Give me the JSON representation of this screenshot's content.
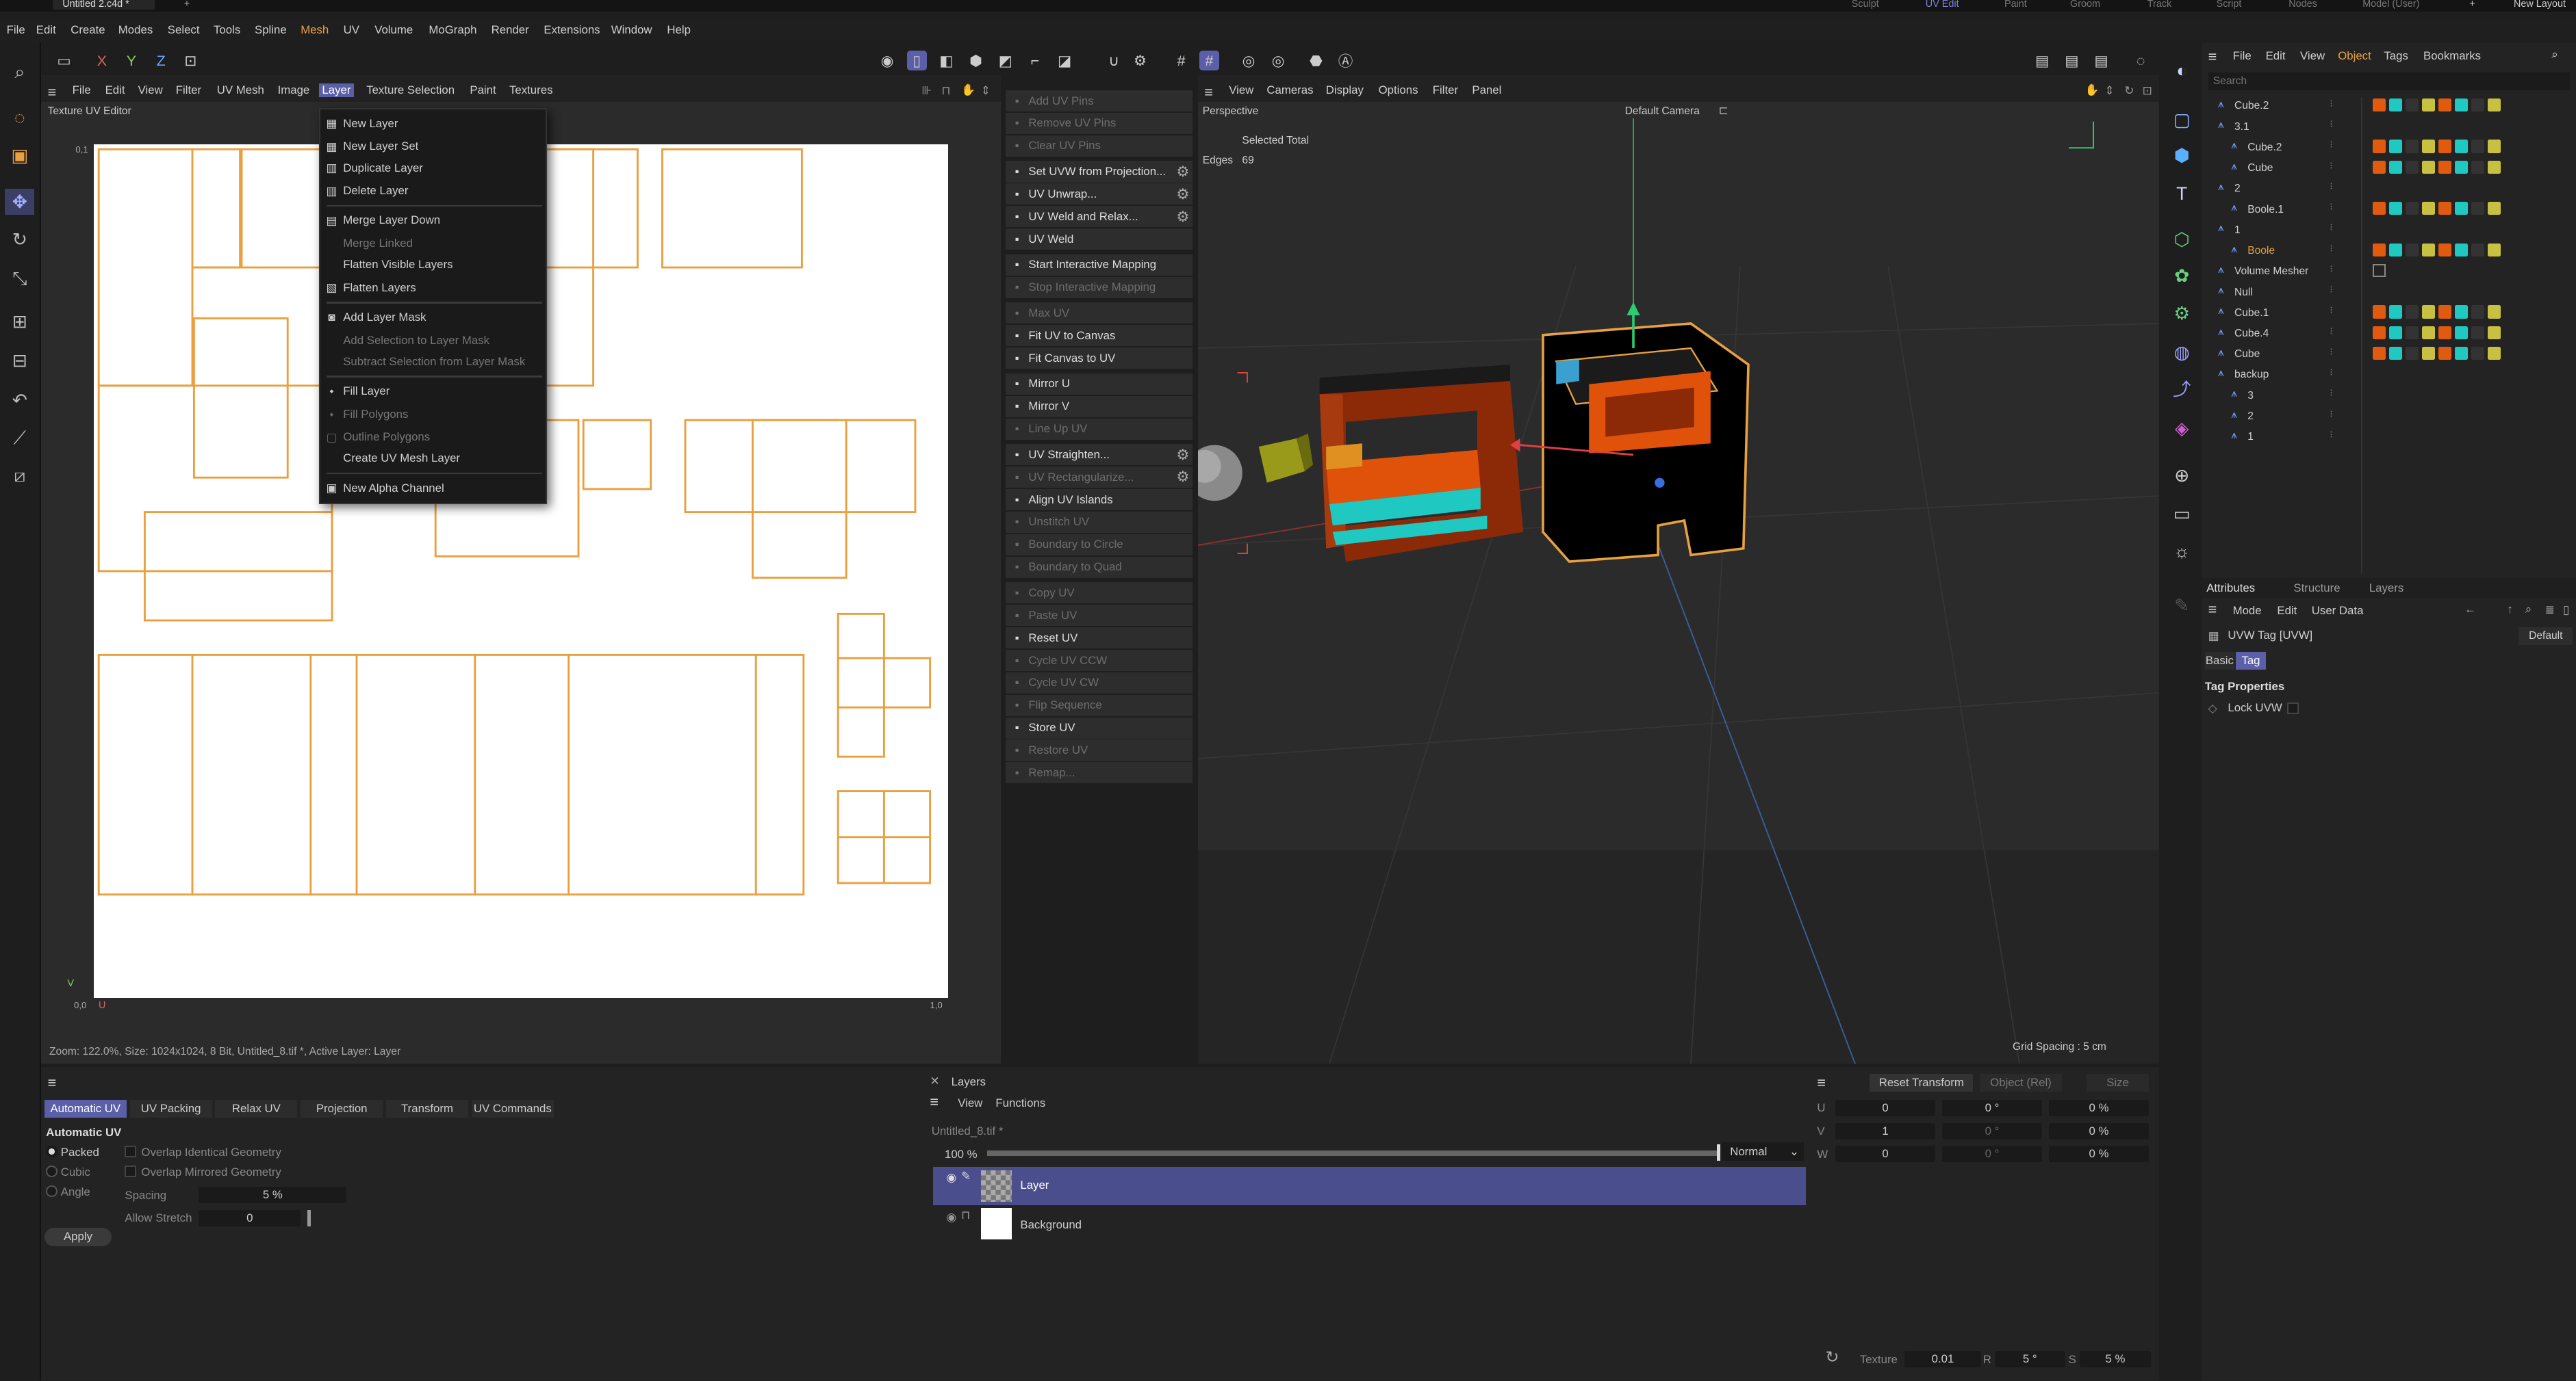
{
  "top_tabs": {
    "doc": "Untitled 2.c4d *",
    "layouts": [
      "Sculpt",
      "UV Edit",
      "Paint",
      "Groom",
      "Track",
      "Script",
      "Nodes",
      "Model (User)"
    ],
    "active_layout": "UV Edit",
    "new_layout": "New Layout"
  },
  "main_menu": [
    "File",
    "Edit",
    "Create",
    "Modes",
    "Select",
    "Tools",
    "Spline",
    "Mesh",
    "UV",
    "Volume",
    "MoGraph",
    "Render",
    "Extensions",
    "Window",
    "Help"
  ],
  "axes": {
    "x": "X",
    "y": "Y",
    "z": "Z"
  },
  "uv_editor": {
    "menu": [
      "File",
      "Edit",
      "View",
      "Filter",
      "UV Mesh",
      "Image",
      "Layer",
      "Texture Selection",
      "Paint",
      "Textures"
    ],
    "active_menu": "Layer",
    "title": "Texture UV Editor",
    "corner_top": "0,1",
    "corner_origin": "0,0",
    "corner_right": "1,0",
    "axis_v": "V",
    "axis_u": "U",
    "status": "Zoom: 122.0%, Size: 1024x1024, 8 Bit, Untitled_8.tif *, Active Layer: Layer"
  },
  "layer_menu": {
    "items": [
      {
        "label": "New Layer",
        "disabled": false,
        "icon": "new-layer-icon"
      },
      {
        "label": "New Layer Set",
        "disabled": false,
        "icon": "new-layer-set-icon"
      },
      {
        "label": "Duplicate Layer",
        "disabled": false,
        "icon": "duplicate-icon"
      },
      {
        "label": "Delete Layer",
        "disabled": false,
        "icon": "delete-icon"
      },
      {
        "label": "Merge Layer Down",
        "disabled": false,
        "icon": "merge-icon"
      },
      {
        "label": "Merge Linked",
        "disabled": true,
        "icon": ""
      },
      {
        "label": "Flatten Visible Layers",
        "disabled": false,
        "icon": ""
      },
      {
        "label": "Flatten Layers",
        "disabled": false,
        "icon": "flatten-icon"
      },
      {
        "label": "Add Layer Mask",
        "disabled": false,
        "icon": "mask-icon"
      },
      {
        "label": "Add Selection to Layer Mask",
        "disabled": true,
        "icon": ""
      },
      {
        "label": "Subtract Selection from Layer Mask",
        "disabled": true,
        "icon": ""
      },
      {
        "label": "Fill Layer",
        "disabled": false,
        "icon": "fill-icon"
      },
      {
        "label": "Fill Polygons",
        "disabled": true,
        "icon": "fill-icon"
      },
      {
        "label": "Outline Polygons",
        "disabled": true,
        "icon": "outline-icon"
      },
      {
        "label": "Create UV Mesh Layer",
        "disabled": false,
        "icon": ""
      },
      {
        "label": "New Alpha Channel",
        "disabled": false,
        "icon": "alpha-icon"
      }
    ]
  },
  "uv_commands": [
    {
      "label": "Add UV Pins",
      "disabled": true,
      "gear": false
    },
    {
      "label": "Remove UV Pins",
      "disabled": true,
      "gear": false
    },
    {
      "label": "Clear UV Pins",
      "disabled": true,
      "gear": false
    },
    {
      "label": "Set UVW from Projection...",
      "disabled": false,
      "gear": true
    },
    {
      "label": "UV Unwrap...",
      "disabled": false,
      "gear": true
    },
    {
      "label": "UV Weld and Relax...",
      "disabled": false,
      "gear": true
    },
    {
      "label": "UV Weld",
      "disabled": false,
      "gear": false
    },
    {
      "label": "Start Interactive Mapping",
      "disabled": false,
      "gear": false
    },
    {
      "label": "Stop Interactive Mapping",
      "disabled": true,
      "gear": false
    },
    {
      "label": "Max UV",
      "disabled": true,
      "gear": false
    },
    {
      "label": "Fit UV to Canvas",
      "disabled": false,
      "gear": false
    },
    {
      "label": "Fit Canvas to UV",
      "disabled": false,
      "gear": false
    },
    {
      "label": "Mirror U",
      "disabled": false,
      "gear": false
    },
    {
      "label": "Mirror V",
      "disabled": false,
      "gear": false
    },
    {
      "label": "Line Up UV",
      "disabled": true,
      "gear": false
    },
    {
      "label": "UV Straighten...",
      "disabled": false,
      "gear": true
    },
    {
      "label": "UV Rectangularize...",
      "disabled": true,
      "gear": true
    },
    {
      "label": "Align UV Islands",
      "disabled": false,
      "gear": false
    },
    {
      "label": "Unstitch UV",
      "disabled": true,
      "gear": false
    },
    {
      "label": "Boundary to Circle",
      "disabled": true,
      "gear": false
    },
    {
      "label": "Boundary to Quad",
      "disabled": true,
      "gear": false
    },
    {
      "label": "Copy UV",
      "disabled": true,
      "gear": false
    },
    {
      "label": "Paste UV",
      "disabled": true,
      "gear": false
    },
    {
      "label": "Reset UV",
      "disabled": false,
      "gear": false
    },
    {
      "label": "Cycle UV CCW",
      "disabled": true,
      "gear": false
    },
    {
      "label": "Cycle UV CW",
      "disabled": true,
      "gear": false
    },
    {
      "label": "Flip Sequence",
      "disabled": true,
      "gear": false
    },
    {
      "label": "Store UV",
      "disabled": false,
      "gear": false
    },
    {
      "label": "Restore UV",
      "disabled": true,
      "gear": false
    },
    {
      "label": "Remap...",
      "disabled": true,
      "gear": false
    }
  ],
  "viewport": {
    "menu": [
      "View",
      "Cameras",
      "Display",
      "Options",
      "Filter",
      "Panel"
    ],
    "name": "Perspective",
    "camera": "Default Camera",
    "stats_header": "Selected Total",
    "stats_label": "Edges",
    "stats_value": "69",
    "grid": "Grid Spacing : 5 cm"
  },
  "object_manager": {
    "menu": [
      "File",
      "Edit",
      "View",
      "Object",
      "Tags",
      "Bookmarks"
    ],
    "active_menu": "Object",
    "search_placeholder": "Search",
    "objects": [
      {
        "name": "Cube.2",
        "depth": 0,
        "selected": false
      },
      {
        "name": "3.1",
        "depth": 0,
        "selected": false
      },
      {
        "name": "Cube.2",
        "depth": 1,
        "selected": false
      },
      {
        "name": "Cube",
        "depth": 1,
        "selected": false
      },
      {
        "name": "2",
        "depth": 0,
        "selected": false
      },
      {
        "name": "Boole.1",
        "depth": 1,
        "selected": false
      },
      {
        "name": "1",
        "depth": 0,
        "selected": false
      },
      {
        "name": "Boole",
        "depth": 1,
        "selected": true
      },
      {
        "name": "Volume Mesher",
        "depth": 0,
        "selected": false
      },
      {
        "name": "Null",
        "depth": 0,
        "selected": false
      },
      {
        "name": "Cube.1",
        "depth": 0,
        "selected": false
      },
      {
        "name": "Cube.4",
        "depth": 0,
        "selected": false
      },
      {
        "name": "Cube",
        "depth": 0,
        "selected": false
      },
      {
        "name": "backup",
        "depth": 0,
        "selected": false
      },
      {
        "name": "3",
        "depth": 1,
        "selected": false
      },
      {
        "name": "2",
        "depth": 1,
        "selected": false
      },
      {
        "name": "1",
        "depth": 1,
        "selected": false
      }
    ]
  },
  "attributes": {
    "tabs": [
      "Attributes",
      "Structure",
      "Layers"
    ],
    "menu": [
      "Mode",
      "Edit",
      "User Data"
    ],
    "tag_name": "UVW Tag [UVW]",
    "preset": "Default",
    "subtabs": [
      "Basic",
      "Tag"
    ],
    "active_subtab": "Tag",
    "section": "Tag Properties",
    "lock_label": "Lock UVW"
  },
  "uv_manager": {
    "tabs": [
      "Automatic UV",
      "UV Packing",
      "Relax UV",
      "Projection",
      "Transform",
      "UV Commands"
    ],
    "active_tab": "Automatic UV",
    "section": "Automatic UV",
    "modes": [
      "Packed",
      "Cubic",
      "Angle"
    ],
    "selected_mode": "Packed",
    "overlap_identical": "Overlap Identical Geometry",
    "overlap_mirrored": "Overlap Mirrored Geometry",
    "spacing_label": "Spacing",
    "spacing_value": "5 %",
    "stretch_label": "Allow Stretch",
    "stretch_value": "0",
    "apply": "Apply"
  },
  "layers_panel": {
    "title": "Layers",
    "menu": [
      "View",
      "Functions"
    ],
    "file": "Untitled_8.tif *",
    "opacity": "100 %",
    "blend": "Normal",
    "layers": [
      {
        "name": "Layer",
        "selected": true
      },
      {
        "name": "Background",
        "selected": false
      }
    ]
  },
  "coords": {
    "reset": "Reset Transform",
    "mode": "Object (Rel)",
    "size_mode": "Size",
    "rows": [
      {
        "axis": "U",
        "pos": "0",
        "rot": "0 °",
        "scale": "0 %"
      },
      {
        "axis": "V",
        "pos": "1",
        "rot": "0 °",
        "scale": "0 %"
      },
      {
        "axis": "W",
        "pos": "0",
        "rot": "0 °",
        "scale": "0 %"
      }
    ],
    "texture_label": "Texture",
    "texture_value": "0.01",
    "r_label": "R",
    "r_value": "5 °",
    "s_label": "S",
    "s_value": "5 %"
  },
  "colors": {
    "accent": "#5a5fa8",
    "uv_line": "#e8a040",
    "selected_object": "#e8a040",
    "orange_obj": "#e05a10",
    "cyan_obj": "#1fc8c0"
  }
}
